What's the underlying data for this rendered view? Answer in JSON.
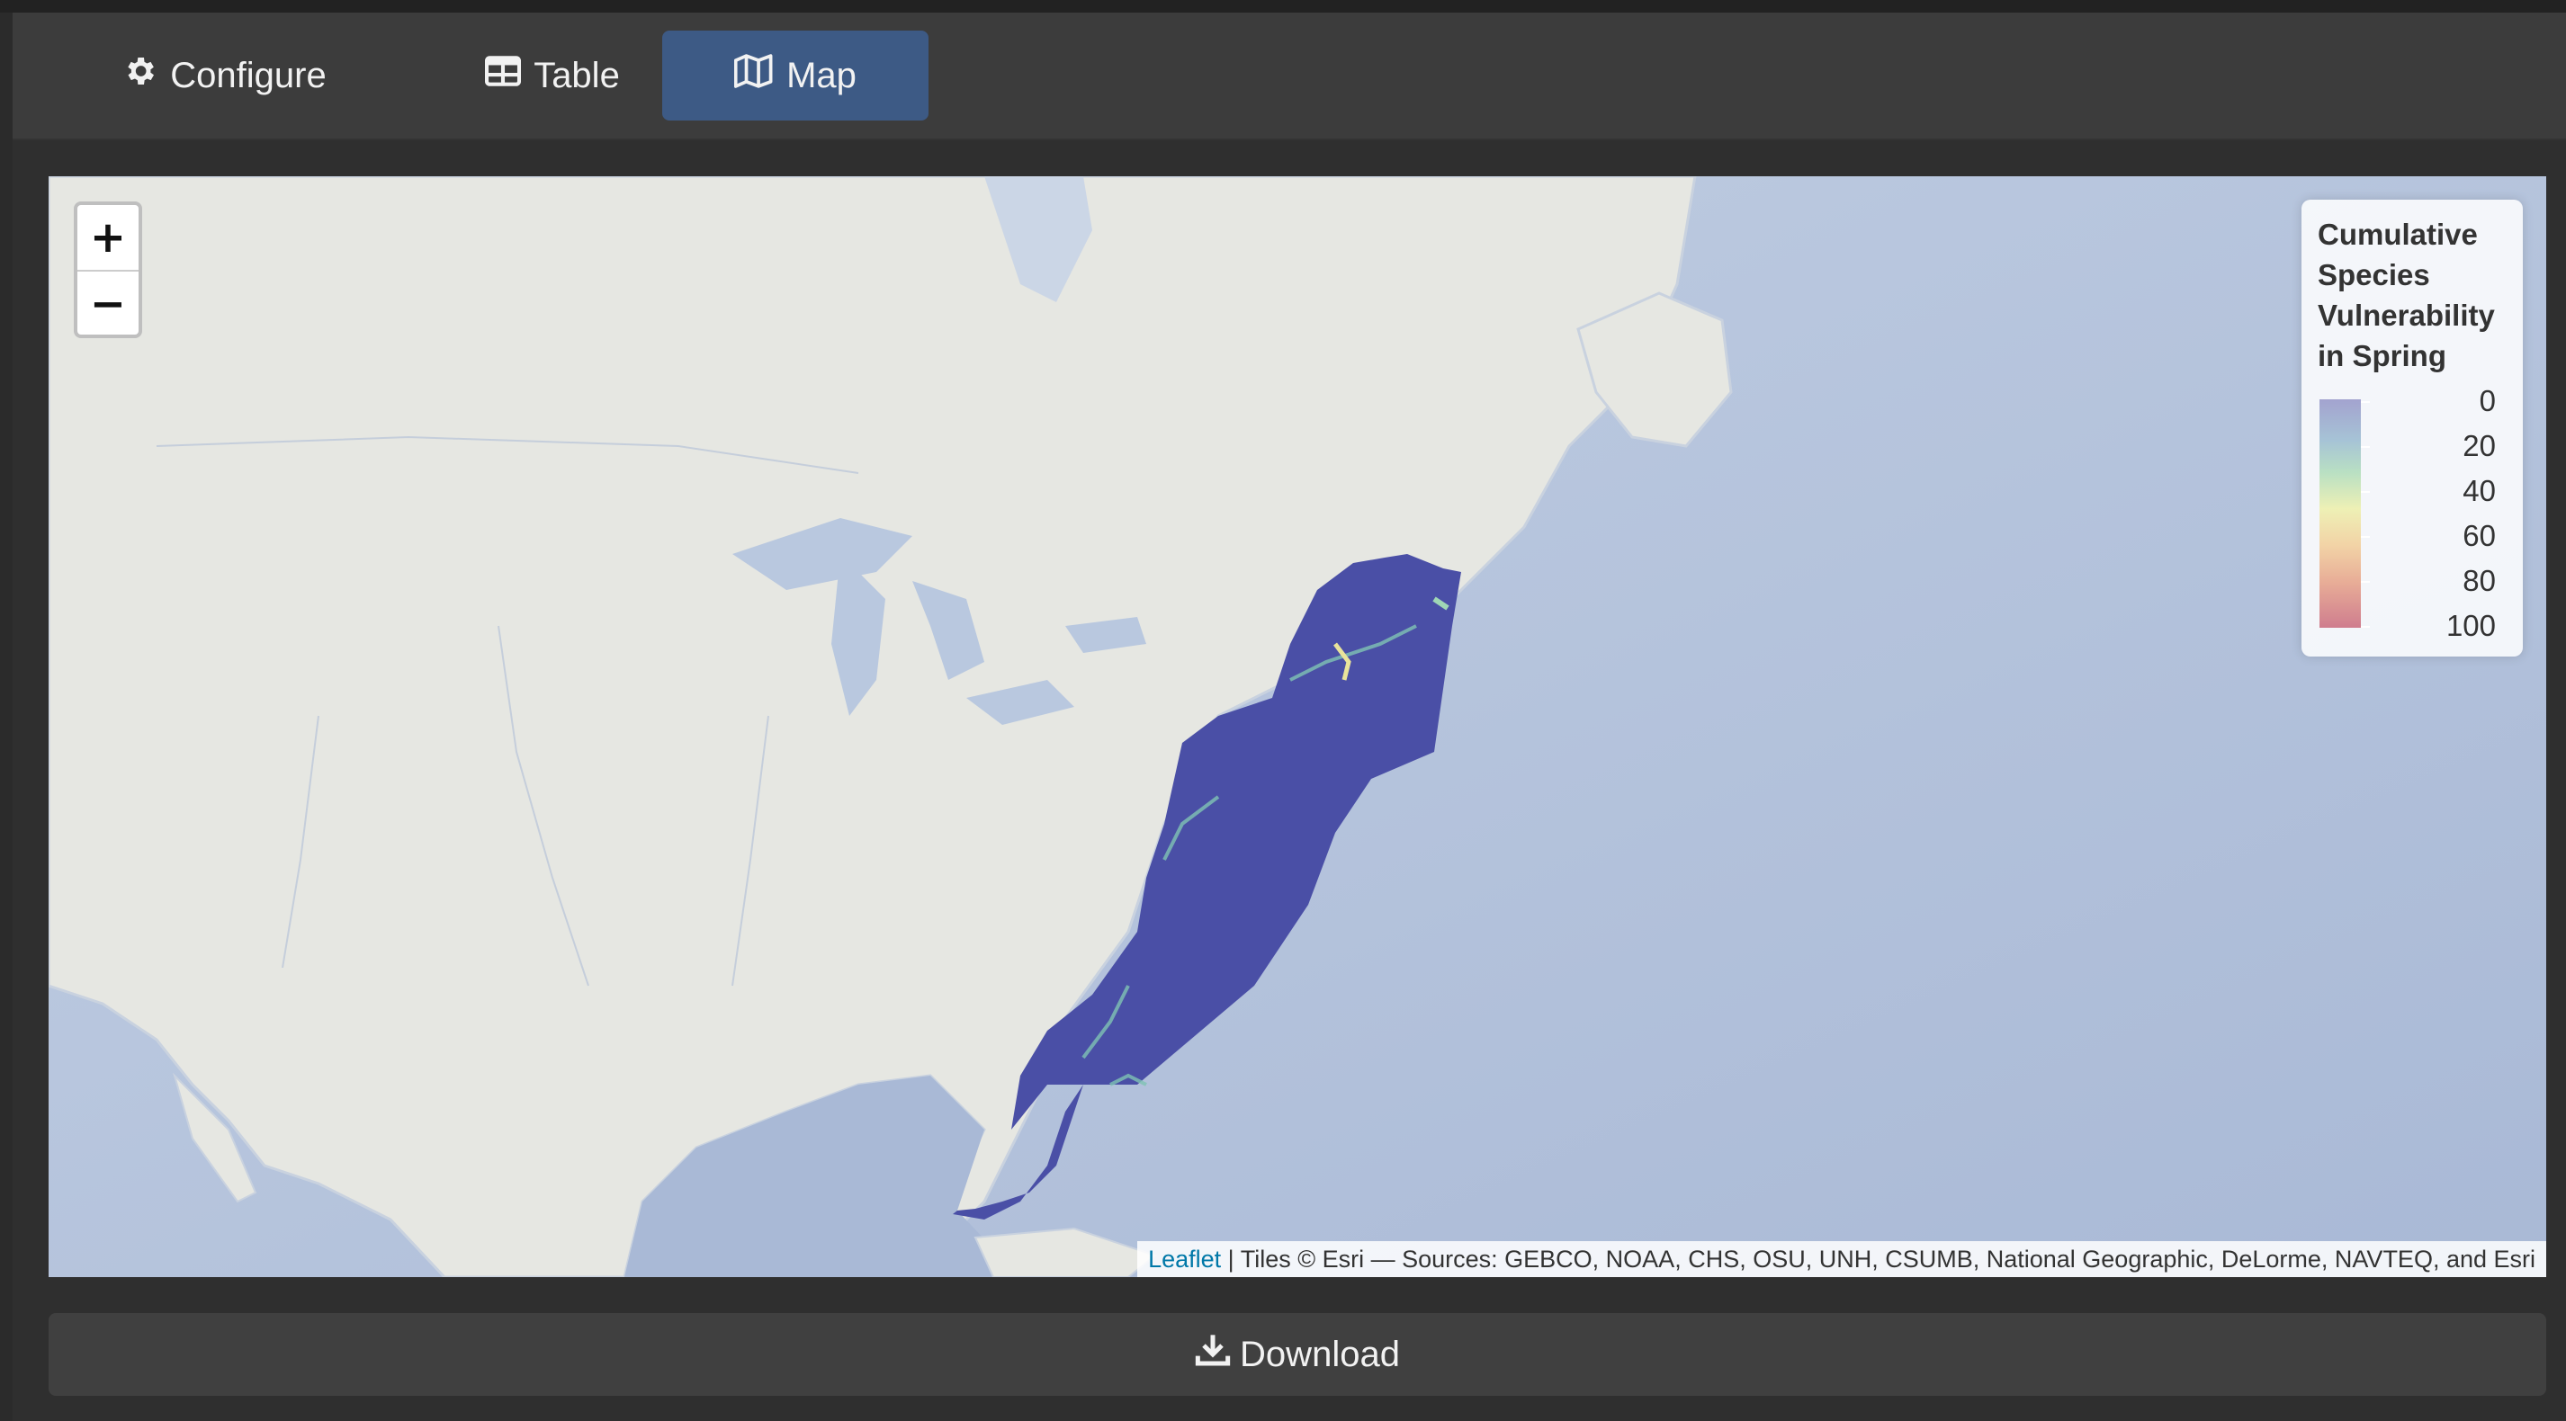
{
  "tabs": {
    "configure": "Configure",
    "table": "Table",
    "map": "Map"
  },
  "map": {
    "zoom_in": "+",
    "zoom_out": "−",
    "legend": {
      "title_lines": [
        "Cumulative",
        "Species",
        "Vulnerability",
        "in Spring"
      ],
      "ticks": [
        "0",
        "20",
        "40",
        "60",
        "80",
        "100"
      ]
    },
    "attribution": {
      "link": "Leaflet",
      "text": " | Tiles © Esri — Sources: GEBCO, NOAA, CHS, OSU, UNH, CSUMB, National Geographic, DeLorme, NAVTEQ, and Esri"
    }
  },
  "download_label": "Download",
  "colors": {
    "active_tab": "#3d5a85",
    "data_layer": "#4a4fa6",
    "ocean": "#b4c3dc",
    "land": "#e6e7e2"
  },
  "icons": {
    "configure": "gear-icon",
    "table": "table-icon",
    "map": "map-icon",
    "download": "download-icon"
  }
}
